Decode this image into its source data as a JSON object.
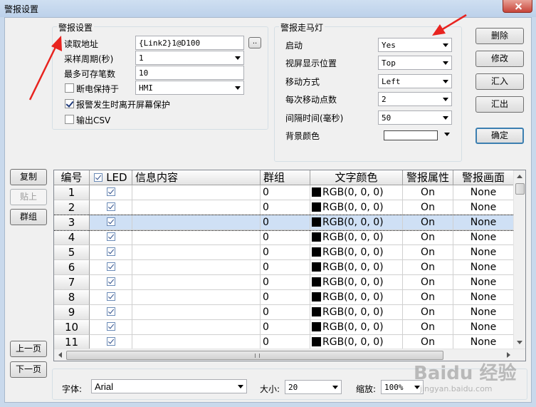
{
  "window": {
    "title": "警报设置"
  },
  "alarm_settings": {
    "group_title": "警报设置",
    "read_address_label": "读取地址",
    "read_address_value": "{Link2}1@D100",
    "browse_label": "..",
    "sample_period_label": "采样周期(秒)",
    "sample_period_value": "1",
    "max_records_label": "最多可存笔数",
    "max_records_value": "10",
    "power_off_label": "断电保持于",
    "power_off_value": "HMI",
    "protect_label": "报警发生时离开屏幕保护",
    "output_csv_label": "输出CSV"
  },
  "marquee": {
    "group_title": "警报走马灯",
    "enable_label": "启动",
    "enable_value": "Yes",
    "screen_position_label": "视屏显示位置",
    "screen_position_value": "Top",
    "move_mode_label": "移动方式",
    "move_mode_value": "Left",
    "move_points_label": "每次移动点数",
    "move_points_value": "2",
    "interval_label": "间隔时间(毫秒)",
    "interval_value": "50",
    "bg_color_label": "背景颜色",
    "bg_color": "#ffffff"
  },
  "buttons": {
    "delete": "删除",
    "modify": "修改",
    "import": "汇入",
    "export": "汇出",
    "ok": "确定",
    "copy": "复制",
    "paste": "贴上",
    "group": "群组",
    "prev_page": "上一页",
    "next_page": "下一页"
  },
  "table": {
    "columns": [
      "编号",
      "LED",
      "信息内容",
      "群组",
      "文字颜色",
      "警报属性",
      "警报画面"
    ],
    "rows": [
      {
        "num": "1",
        "led": true,
        "message": "",
        "group": "0",
        "color": "RGB(0, 0, 0)",
        "attr": "On",
        "screen": "None"
      },
      {
        "num": "2",
        "led": true,
        "message": "",
        "group": "0",
        "color": "RGB(0, 0, 0)",
        "attr": "On",
        "screen": "None"
      },
      {
        "num": "3",
        "led": true,
        "message": "",
        "group": "0",
        "color": "RGB(0, 0, 0)",
        "attr": "On",
        "screen": "None"
      },
      {
        "num": "4",
        "led": true,
        "message": "",
        "group": "0",
        "color": "RGB(0, 0, 0)",
        "attr": "On",
        "screen": "None"
      },
      {
        "num": "5",
        "led": true,
        "message": "",
        "group": "0",
        "color": "RGB(0, 0, 0)",
        "attr": "On",
        "screen": "None"
      },
      {
        "num": "6",
        "led": true,
        "message": "",
        "group": "0",
        "color": "RGB(0, 0, 0)",
        "attr": "On",
        "screen": "None"
      },
      {
        "num": "7",
        "led": true,
        "message": "",
        "group": "0",
        "color": "RGB(0, 0, 0)",
        "attr": "On",
        "screen": "None"
      },
      {
        "num": "8",
        "led": true,
        "message": "",
        "group": "0",
        "color": "RGB(0, 0, 0)",
        "attr": "On",
        "screen": "None"
      },
      {
        "num": "9",
        "led": true,
        "message": "",
        "group": "0",
        "color": "RGB(0, 0, 0)",
        "attr": "On",
        "screen": "None"
      },
      {
        "num": "10",
        "led": true,
        "message": "",
        "group": "0",
        "color": "RGB(0, 0, 0)",
        "attr": "On",
        "screen": "None"
      },
      {
        "num": "11",
        "led": true,
        "message": "",
        "group": "0",
        "color": "RGB(0, 0, 0)",
        "attr": "On",
        "screen": "None"
      }
    ],
    "selected_row": "3"
  },
  "font_bar": {
    "font_label": "字体:",
    "font_value": "Arial",
    "size_label": "大小:",
    "size_value": "20",
    "zoom_label": "缩放:",
    "zoom_value": "100%"
  },
  "watermark": {
    "logo": "Baidu 经验",
    "url": "jingyan.baidu.com"
  },
  "colors": {
    "annotation_arrow": "#e8231f",
    "selected_row": "#cfe0f5",
    "default_button_border": "#3c7fb1"
  },
  "icons": [
    "close-icon",
    "dropdown-arrow-icon",
    "checkbox-icon",
    "color-swatch-icon",
    "scroll-arrow-icon",
    "annotation-arrow-icon"
  ]
}
